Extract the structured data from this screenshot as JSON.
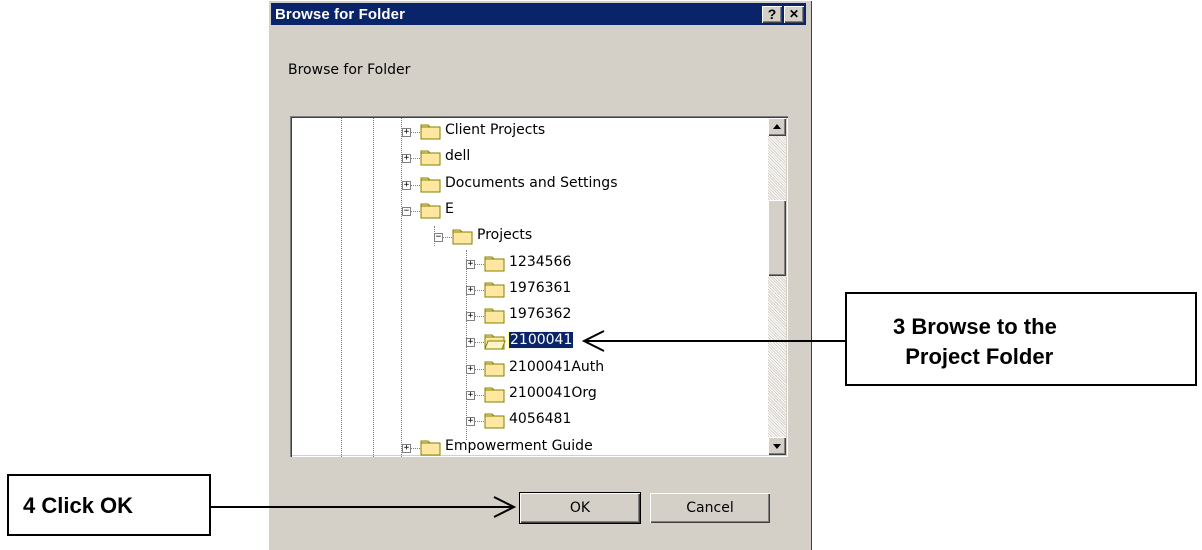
{
  "dialog": {
    "title": "Browse for Folder",
    "help_button": "?",
    "close_button": "✕",
    "prompt": "Browse for Folder",
    "ok_label": "OK",
    "cancel_label": "Cancel"
  },
  "tree": {
    "items": [
      {
        "label": "Client Projects",
        "expander": "+",
        "selected": false
      },
      {
        "label": "dell",
        "expander": "+",
        "selected": false
      },
      {
        "label": "Documents and Settings",
        "expander": "+",
        "selected": false
      },
      {
        "label": "E",
        "expander": "−",
        "selected": false
      },
      {
        "label": "Projects",
        "expander": "−",
        "selected": false
      },
      {
        "label": "1234566",
        "expander": "+",
        "selected": false
      },
      {
        "label": "1976361",
        "expander": "+",
        "selected": false
      },
      {
        "label": "1976362",
        "expander": "+",
        "selected": false
      },
      {
        "label": "2100041",
        "expander": "+",
        "selected": true
      },
      {
        "label": "2100041Auth",
        "expander": "+",
        "selected": false
      },
      {
        "label": "2100041Org",
        "expander": "+",
        "selected": false
      },
      {
        "label": "4056481",
        "expander": "+",
        "selected": false
      },
      {
        "label": "Empowerment Guide",
        "expander": "+",
        "selected": false
      }
    ]
  },
  "callouts": {
    "browse": "3 Browse to the\n  Project Folder",
    "click_ok": "4 Click OK"
  },
  "colors": {
    "titlebar": "#0a246a",
    "face": "#d4d0c8",
    "folder": "#ffe7a0",
    "selection": "#0a246a"
  }
}
